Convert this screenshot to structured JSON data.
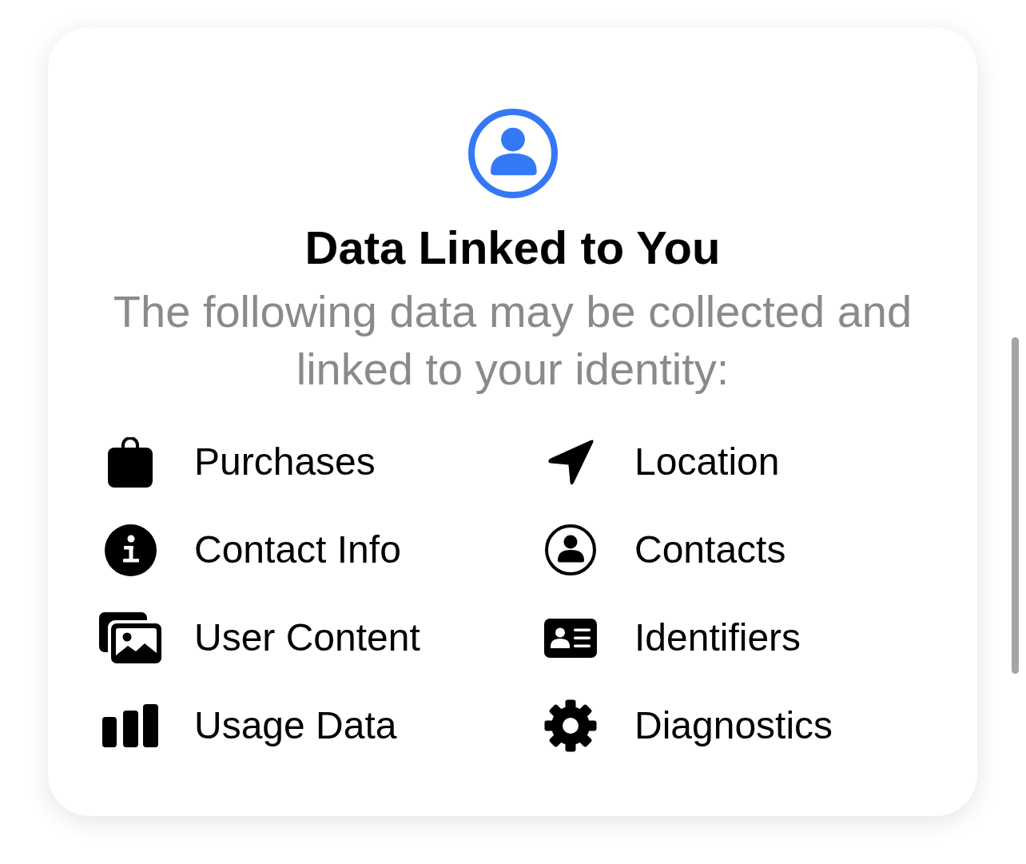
{
  "header": {
    "title": "Data Linked to You",
    "subtitle": "The following data may be collected and linked to your identity:"
  },
  "items": [
    {
      "label": "Purchases"
    },
    {
      "label": "Location"
    },
    {
      "label": "Contact Info"
    },
    {
      "label": "Contacts"
    },
    {
      "label": "User Content"
    },
    {
      "label": "Identifiers"
    },
    {
      "label": "Usage Data"
    },
    {
      "label": "Diagnostics"
    }
  ]
}
